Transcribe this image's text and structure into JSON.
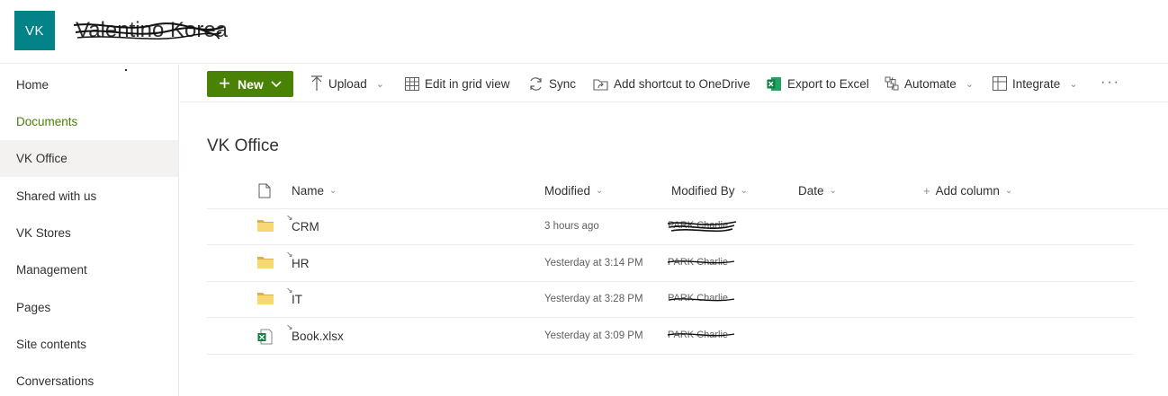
{
  "header": {
    "logo_text": "VK",
    "site_title": "Valentino Korea",
    "logo_color": "#038387"
  },
  "leftnav": {
    "items": [
      {
        "label": "Home"
      },
      {
        "label": "Documents"
      },
      {
        "label": "VK Office"
      },
      {
        "label": "Shared with us"
      },
      {
        "label": "VK Stores"
      },
      {
        "label": "Management"
      },
      {
        "label": "Pages"
      },
      {
        "label": "Site contents"
      },
      {
        "label": "Conversations"
      }
    ],
    "selected": "VK Office",
    "accent_color": "#498205"
  },
  "commandbar": {
    "new_label": "New",
    "upload_label": "Upload",
    "grid_label": "Edit in grid view",
    "sync_label": "Sync",
    "shortcut_label": "Add shortcut to OneDrive",
    "export_label": "Export to Excel",
    "automate_label": "Automate",
    "integrate_label": "Integrate",
    "more_label": "···"
  },
  "library": {
    "title": "VK Office",
    "columns": {
      "name": "Name",
      "modified": "Modified",
      "modified_by": "Modified By",
      "date": "Date",
      "add_column": "Add column"
    },
    "rows": [
      {
        "name": "CRM",
        "type": "folder-icon",
        "modified": "3 hours ago",
        "modified_by": "PARK Charlie"
      },
      {
        "name": "HR",
        "type": "folder-icon",
        "modified": "Yesterday at 3:14 PM",
        "modified_by": "PARK Charlie"
      },
      {
        "name": "IT",
        "type": "folder-icon",
        "modified": "Yesterday at 3:28 PM",
        "modified_by": "PARK Charlie"
      },
      {
        "name": "Book.xlsx",
        "type": "excel-file-icon",
        "modified": "Yesterday at 3:09 PM",
        "modified_by": "PARK Charlie"
      }
    ]
  }
}
